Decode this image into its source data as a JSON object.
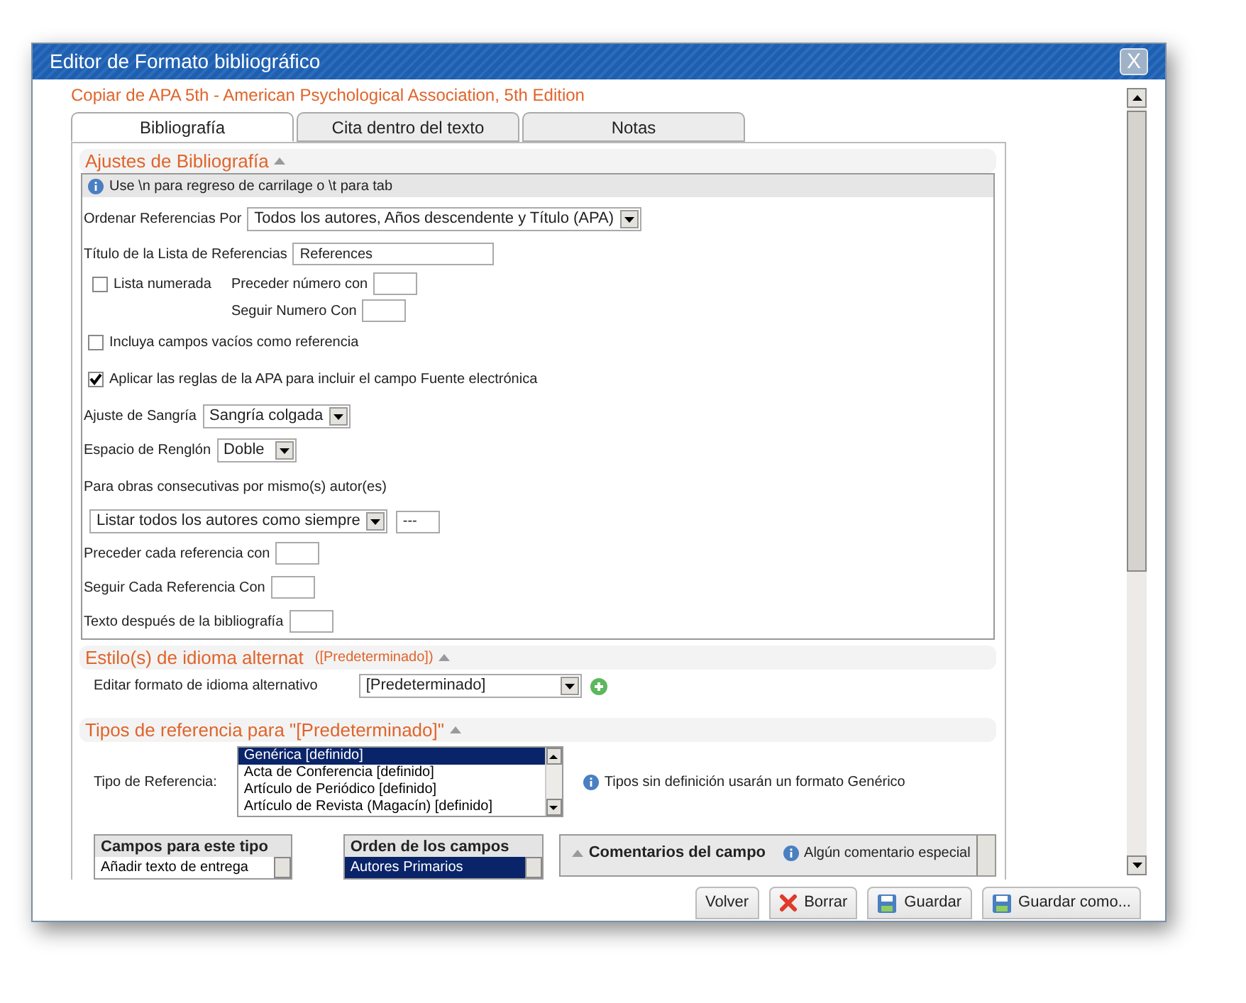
{
  "window": {
    "title": "Editor de Formato bibliográfico",
    "close": "X"
  },
  "subtitle": "Copiar de APA 5th - American Psychological Association, 5th Edition",
  "tabs": [
    {
      "label": "Bibliografía",
      "selected": true
    },
    {
      "label": "Cita dentro del texto",
      "selected": false
    },
    {
      "label": "Notas",
      "selected": false
    }
  ],
  "bibliography_settings": {
    "heading": "Ajustes de Bibliografía",
    "hint": "Use \\n para regreso de carrilage o \\t para tab",
    "sort": {
      "label": "Ordenar Referencias Por",
      "value": "Todos los autores, Años descendente y Título (APA)"
    },
    "list_title": {
      "label": "Título de la Lista de Referencias",
      "value": "References"
    },
    "numbered": {
      "label": "Lista numerada",
      "checked": false
    },
    "precede_number": {
      "label": "Preceder número con"
    },
    "follow_number": {
      "label": "Seguir Numero Con"
    },
    "include_empty": {
      "label": "Incluya campos vacíos como referencia",
      "checked": false
    },
    "apa_rules": {
      "label": "Aplicar las reglas de la APA para incluir el campo Fuente electrónica",
      "checked": true
    },
    "indent": {
      "label": "Ajuste de Sangría",
      "value": "Sangría colgada"
    },
    "spacing": {
      "label": "Espacio de Renglón",
      "value": "Doble"
    },
    "consecutive": {
      "label": "Para obras consecutivas por mismo(s) autor(es)",
      "value": "Listar todos los autores como siempre",
      "text": "---"
    },
    "precede_each": {
      "label": "Preceder cada referencia con"
    },
    "follow_each": {
      "label": "Seguir Cada Referencia Con"
    },
    "after_text": {
      "label": "Texto después de la bibliografía"
    }
  },
  "alt_language": {
    "heading": "Estilo(s) de idioma alternat",
    "tag": "([Predeterminado])",
    "label": "Editar formato de idioma alternativo",
    "value": "[Predeterminado]"
  },
  "reference_types": {
    "heading": "Tipos de referencia para \"[Predeterminado]\"",
    "label": "Tipo de Referencia:",
    "items": [
      {
        "label": "Genérica [definido]",
        "selected": true
      },
      {
        "label": "Acta de Conferencia [definido]",
        "selected": false
      },
      {
        "label": "Artículo de Periódico [definido]",
        "selected": false
      },
      {
        "label": "Artículo de Revista (Magacín) [definido]",
        "selected": false
      }
    ],
    "note": "Tipos sin definición usarán un formato Genérico"
  },
  "fields_panel": {
    "heading": "Campos para este tipo",
    "items": [
      {
        "label": "Añadir texto de entrega",
        "selected": false
      }
    ]
  },
  "order_panel": {
    "heading": "Orden de los campos",
    "items": [
      {
        "label": "Autores Primarios",
        "selected": true
      }
    ]
  },
  "comments": {
    "heading": "Comentarios del campo",
    "note": "Algún comentario especial"
  },
  "buttons": [
    {
      "label": "Volver",
      "kind": "plain"
    },
    {
      "label": "Borrar",
      "kind": "delete"
    },
    {
      "label": "Guardar",
      "kind": "save"
    },
    {
      "label": "Guardar como...",
      "kind": "save"
    }
  ]
}
